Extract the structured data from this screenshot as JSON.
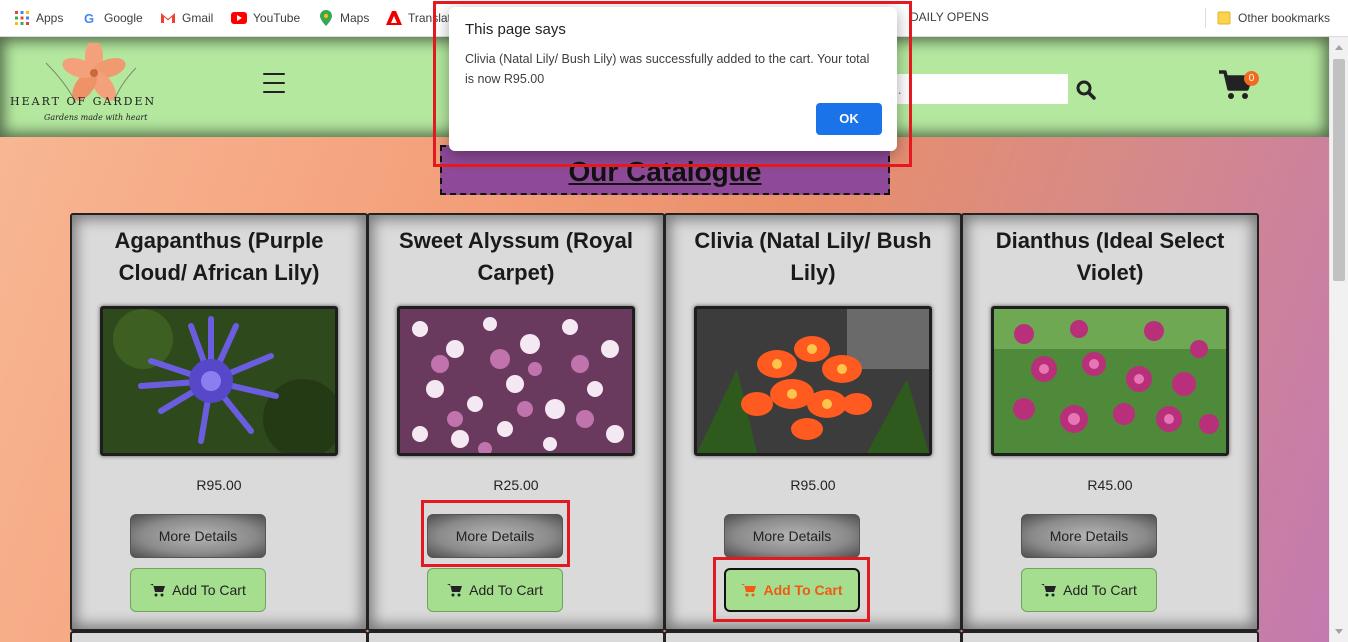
{
  "bookmarks": {
    "items": [
      {
        "label": "Apps",
        "icon": "apps-grid-icon"
      },
      {
        "label": "Google",
        "icon": "google-icon"
      },
      {
        "label": "Gmail",
        "icon": "gmail-icon"
      },
      {
        "label": "YouTube",
        "icon": "youtube-icon"
      },
      {
        "label": "Maps",
        "icon": "maps-icon"
      },
      {
        "label": "Translat",
        "icon": "adobe-icon"
      },
      {
        "label": "DAILY OPENS",
        "icon": ""
      }
    ],
    "other": "Other bookmarks"
  },
  "header": {
    "logo_text": "HEART OF GARDEN",
    "logo_tagline": "Gardens made with heart",
    "search_placeholder": "...",
    "cart_count": "0"
  },
  "catalogue": {
    "title": "Our Catalogue"
  },
  "products": [
    {
      "name": "Agapanthus (Purple Cloud/ African Lily)",
      "price": "R95.00",
      "details_label": "More Details",
      "cart_label": "Add To Cart"
    },
    {
      "name": "Sweet Alyssum (Royal Carpet)",
      "price": "R25.00",
      "details_label": "More Details",
      "cart_label": "Add To Cart"
    },
    {
      "name": "Clivia (Natal Lily/ Bush Lily)",
      "price": "R95.00",
      "details_label": "More Details",
      "cart_label": "Add To Cart"
    },
    {
      "name": "Dianthus (Ideal Select Violet)",
      "price": "R45.00",
      "details_label": "More Details",
      "cart_label": "Add To Cart"
    }
  ],
  "dialog": {
    "title": "This page says",
    "message": "Clivia (Natal Lily/ Bush Lily) was successfully added to the cart. Your total is now R95.00",
    "ok_label": "OK"
  },
  "colors": {
    "header_bg": "#b4e89f",
    "catalogue_bg": "#8e4a98",
    "highlight": "#e4181f",
    "dialog_button": "#1a73e8",
    "cart_active_text": "#f05a14"
  }
}
